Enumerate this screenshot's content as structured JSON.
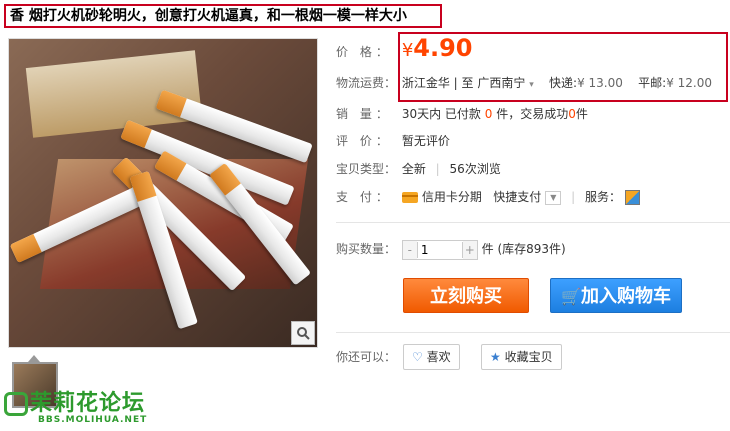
{
  "title": "香 烟打火机砂轮明火，创意打火机逼真，和一根烟一模一样大小",
  "price": {
    "label": "价      格：",
    "currency": "¥",
    "value": "4.90"
  },
  "shipping": {
    "label": "物流运费：",
    "from": "浙江金华",
    "divider": "|",
    "to_prefix": "至",
    "to": "广西南宁",
    "express_label": "快递:",
    "express_price": "¥ 13.00",
    "post_label": "平邮:",
    "post_price": "¥ 12.00"
  },
  "sales": {
    "label": "销      量：",
    "prefix": "30天内 已付款",
    "paid": "0",
    "mid": "件，交易成功",
    "success": "0",
    "suffix": "件"
  },
  "rating": {
    "label": "评      价：",
    "value": "暂无评价"
  },
  "item_type": {
    "label": "宝贝类型：",
    "value": "全新",
    "divider": "|",
    "views": "56次浏览"
  },
  "payment": {
    "label": "支      付：",
    "credit": "信用卡分期",
    "quick": "快捷支付",
    "divider": "|",
    "service": "服务："
  },
  "quantity": {
    "label": "购买数量：",
    "value": "1",
    "minus": "-",
    "plus": "+",
    "stock_text": "件 (库存893件)"
  },
  "buttons": {
    "buy": "立刻购买",
    "cart": "加入购物车"
  },
  "extras": {
    "label": "你还可以：",
    "like": "喜欢",
    "collect": "收藏宝贝"
  },
  "watermark": {
    "name": "茉莉花论坛",
    "url": "BBS.MOLIHUA.NET"
  },
  "icons": {
    "zoom": "zoom-icon",
    "heart": "heart-icon",
    "star": "star-icon",
    "cart": "cart-icon"
  }
}
